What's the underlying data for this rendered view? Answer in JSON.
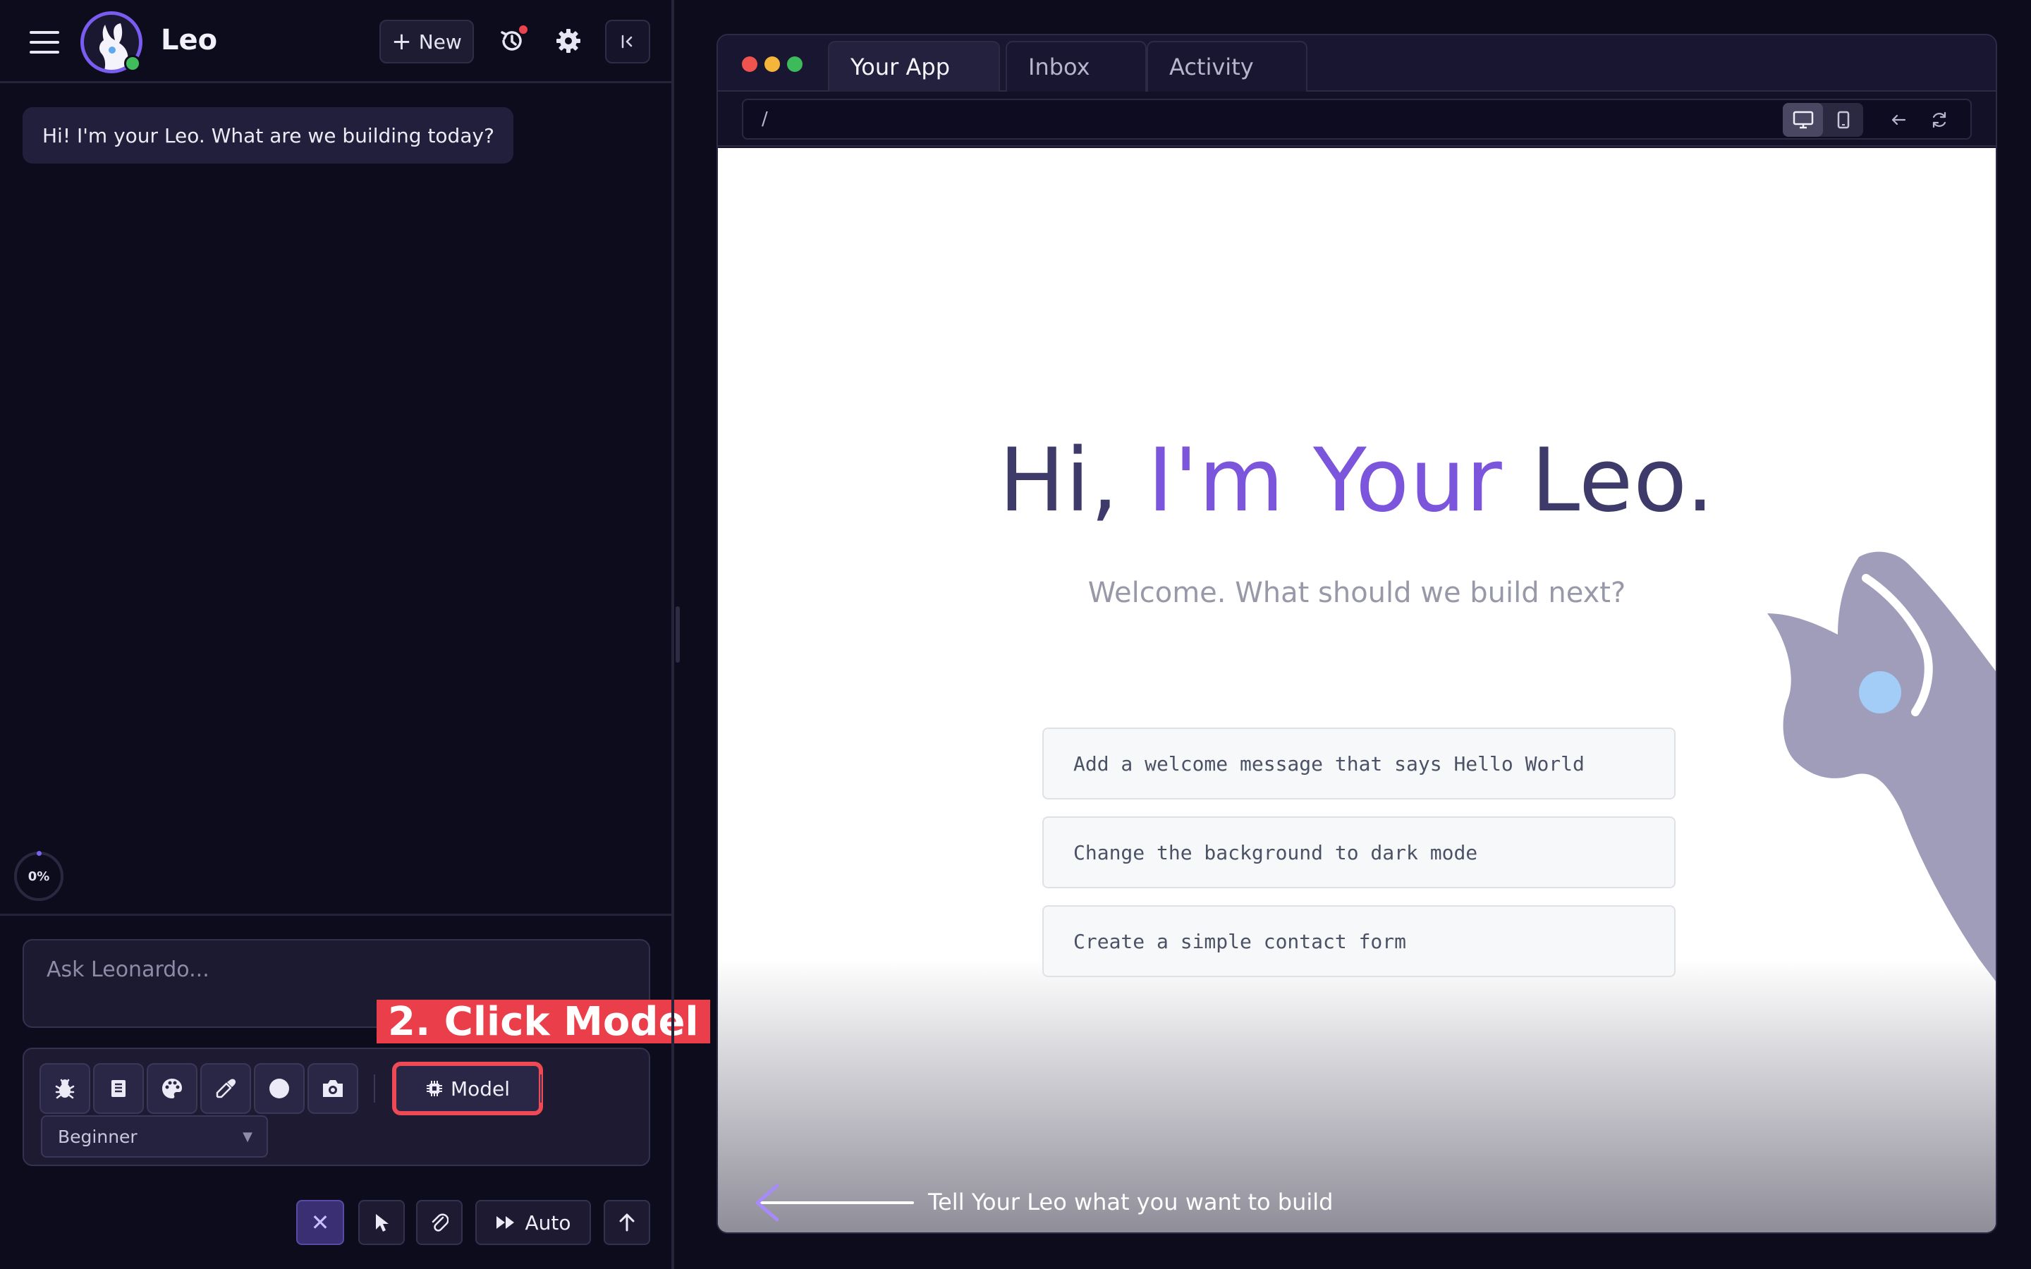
{
  "sidebar": {
    "menu_icon": "hamburger-icon",
    "logo_icon": "leo-llama-logo",
    "app_name": "Leo",
    "new_button": {
      "icon": "plus-icon",
      "label": "New"
    },
    "history_icon": "history-icon",
    "settings_icon": "gear-icon",
    "collapse_icon": "collapse-left-icon",
    "greeting_message": "Hi! I'm your Leo. What are we building today?",
    "progress_label": "0%",
    "progress_value": 0,
    "prompt_placeholder": "Ask Leonardo...",
    "tools": [
      {
        "name": "bug-icon"
      },
      {
        "name": "book-icon"
      },
      {
        "name": "palette-icon"
      },
      {
        "name": "eyedropper-icon"
      },
      {
        "name": "circle-icon"
      },
      {
        "name": "camera-icon"
      }
    ],
    "model_button": {
      "icon": "chip-icon",
      "label": "Model"
    },
    "level_select": {
      "value": "Beginner"
    },
    "callout": "2. Click Model",
    "bottom_actions": {
      "stop_icon": "close-icon",
      "pointer_icon": "cursor-icon",
      "attach_icon": "paperclip-icon",
      "auto_icon": "fast-forward-icon",
      "auto_label": "Auto",
      "send_icon": "arrow-up-icon"
    }
  },
  "preview_window": {
    "tabs": [
      {
        "label": "Your App",
        "active": true
      },
      {
        "label": "Inbox",
        "active": false
      },
      {
        "label": "Activity",
        "active": false
      }
    ],
    "url": "/",
    "device_toggle": {
      "selected": "desktop",
      "options": [
        "desktop-icon",
        "mobile-icon"
      ]
    },
    "back_icon": "arrow-left-icon",
    "refresh_icon": "refresh-icon",
    "hero": {
      "title_part1": "Hi, ",
      "title_part2": "I'm Your ",
      "title_part3": "Leo.",
      "subtitle": "Welcome. What should we build next?"
    },
    "suggestions": [
      "Add a welcome message that says Hello World",
      "Change the background to dark mode",
      "Create a simple contact form"
    ],
    "hint_text": "Tell Your Leo what you want to build",
    "hint_icon": "arrow-left-icon"
  },
  "colors": {
    "accent": "#7b55db",
    "background": "#0d0c1d",
    "highlight": "#ea3f4a"
  }
}
